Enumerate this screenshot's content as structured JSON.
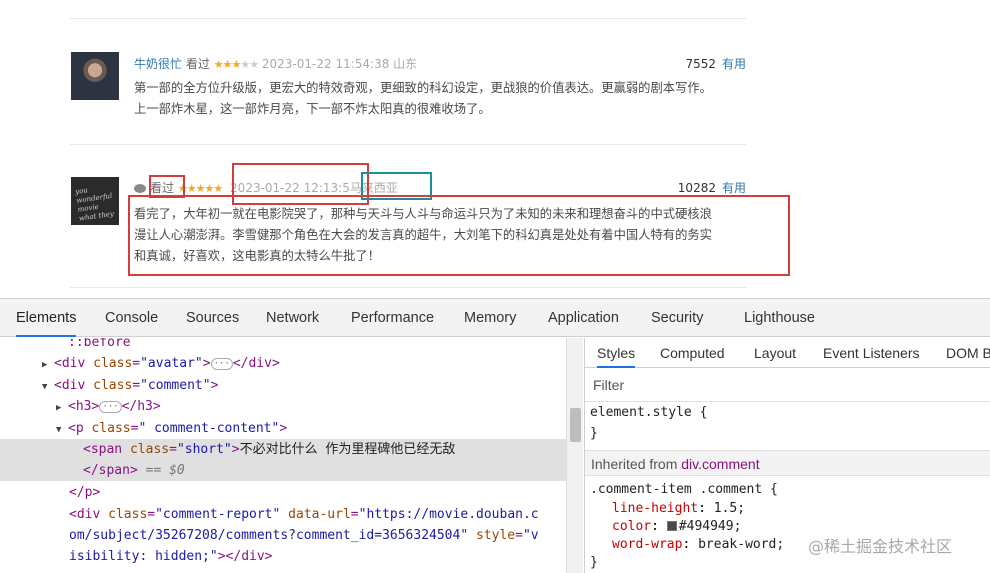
{
  "comments": [
    {
      "username": "牛奶很忙",
      "status": "看过",
      "stars_filled": 3,
      "stars_total": 5,
      "time": "2023-01-22 11:54:38",
      "location": "山东",
      "votes": "7552",
      "useful_label": "有用",
      "line1": "第一部的全方位升级版，更宏大的特效奇观，更细致的科幻设定，更战狼的价值表达。更赢弱的剧本写作。",
      "line2": "上一部炸木星，这一部炸月亮，下一部不炸太阳真的很难收场了。"
    },
    {
      "username": "",
      "status": "看过",
      "stars_filled": 5,
      "stars_total": 5,
      "time": "2023-01-22 12:13:5",
      "location": "马来西亚",
      "votes": "10282",
      "useful_label": "有用",
      "line1": "看完了，大年初一就在电影院哭了，那种与天斗与人斗与命运斗只为了未知的未来和理想奋斗的中式硬核浪",
      "line2": "漫让人心潮澎湃。李雪健那个角色在大会的发言真的超牛，大刘笔下的科幻真是处处有着中国人特有的务实",
      "line3": "和真诚，好喜欢，这电影真的太特么牛批了！"
    }
  ],
  "devtools": {
    "tabs": [
      "Elements",
      "Console",
      "Sources",
      "Network",
      "Performance",
      "Memory",
      "Application",
      "Security",
      "Lighthouse"
    ],
    "active_tab": "Elements",
    "dom": {
      "l1": "::before",
      "l2_tag_open": "<div ",
      "l2_attr": "class",
      "l2_val": "\"avatar\"",
      "l2_close": "</div>",
      "l3_attr": "class",
      "l3_val": "\"comment\"",
      "l4_open": "<h3>",
      "l4_close": "</h3>",
      "l5_attr": "class",
      "l5_val": "\" comment-content\"",
      "l6_attr": "class",
      "l6_val": "\"short\"",
      "l6_text": "不必对比什么 作为里程碑他已经无敌",
      "l7_close": "</span>",
      "l7_eq": "== $0",
      "l8_close": "</p>",
      "l9_attr1": "class",
      "l9_val1": "\"comment-report\"",
      "l9_attr2": "data-url",
      "l9_val2_part": "\"https://movie.douban.c",
      "l10_val2_part": "om/subject/35267208/comments?comment_id=3656324504\"",
      "l10_attr3": "style",
      "l10_val3_part": "\"v",
      "l11_val3_part": "isibility: hidden;\"",
      "l11_close": "></div>"
    },
    "styles_tabs": [
      "Styles",
      "Computed",
      "Layout",
      "Event Listeners",
      "DOM B"
    ],
    "active_styles_tab": "Styles",
    "filter_placeholder": "Filter",
    "element_style": "element.style {",
    "close_brace": "}",
    "inherited_label": "Inherited from",
    "inherited_from": "div.comment",
    "rule_selector": ".comment-item .comment {",
    "rules": [
      {
        "prop": "line-height",
        "value": "1.5;"
      },
      {
        "prop": "color",
        "value": "#494949;"
      },
      {
        "prop": "word-wrap",
        "value": "break-word;"
      }
    ],
    "text_color": "#494949"
  },
  "watermark": "@稀土掘金技术社区",
  "colors": {
    "link": "#3377aa",
    "star": "#f5a623",
    "highlight_red": "#d23d3d",
    "highlight_teal": "#1f8e96",
    "devtools_accent": "#1a73e8"
  }
}
